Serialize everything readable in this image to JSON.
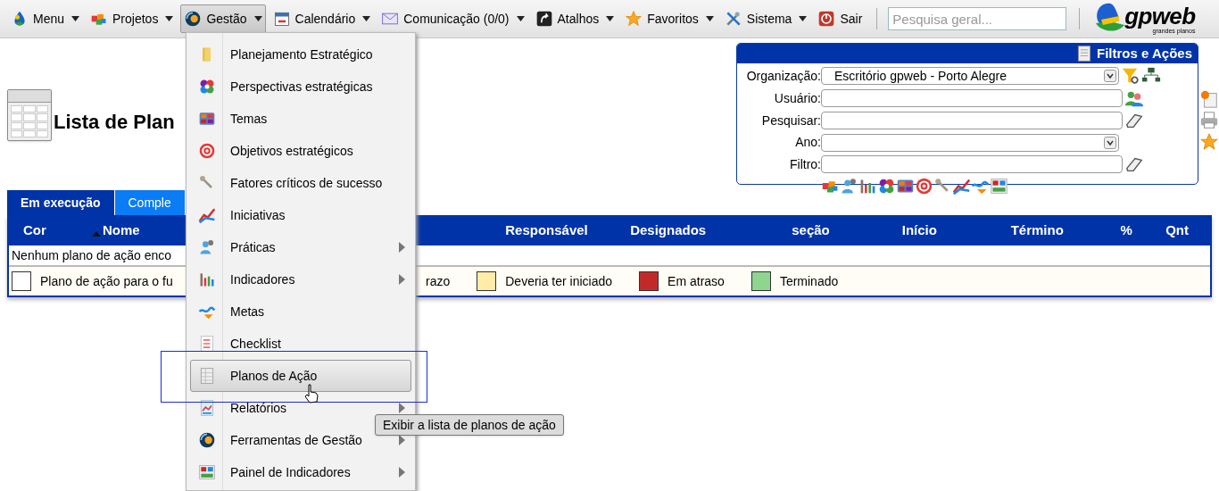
{
  "top_menu": [
    {
      "label": "Menu",
      "has_caret": true,
      "selected": false
    },
    {
      "label": "Projetos",
      "has_caret": true,
      "selected": false
    },
    {
      "label": "Gestão",
      "has_caret": true,
      "selected": true
    },
    {
      "label": "Calendário",
      "has_caret": true,
      "selected": false
    },
    {
      "label": "Comunicação (0/0)",
      "has_caret": true,
      "selected": false
    },
    {
      "label": "Atalhos",
      "has_caret": true,
      "selected": false
    },
    {
      "label": "Favoritos",
      "has_caret": true,
      "selected": false
    },
    {
      "label": "Sistema",
      "has_caret": true,
      "selected": false
    },
    {
      "label": "Sair",
      "has_caret": false,
      "selected": false
    }
  ],
  "search": {
    "placeholder": "Pesquisa geral..."
  },
  "logo": {
    "name": "gpweb",
    "tagline": "grandes planos"
  },
  "page_title": "Lista de Plan",
  "filters": {
    "title": "Filtros e Ações",
    "fields": [
      {
        "label": "Organização:",
        "kind": "select",
        "value": "Escritório gpweb - Porto Alegre"
      },
      {
        "label": "Usuário:",
        "kind": "input"
      },
      {
        "label": "Pesquisar:",
        "kind": "input"
      },
      {
        "label": "Ano:",
        "kind": "select"
      },
      {
        "label": "Filtro:",
        "kind": "input"
      }
    ]
  },
  "tabs": [
    {
      "label": "Em execução",
      "selected": true
    },
    {
      "label": "Comple",
      "selected": false
    }
  ],
  "table": {
    "columns": [
      "Cor",
      "Nome",
      "Responsável",
      "Designados",
      "seção",
      "Início",
      "Término",
      "%",
      "Qnt"
    ],
    "empty_message": "Nenhum plano de ação enco"
  },
  "legend": [
    {
      "label": "Plano de ação para o fu",
      "color": "#ffffff"
    },
    {
      "label": "razo"
    },
    {
      "label": "Deveria ter iniciado",
      "color": "#ffeca8"
    },
    {
      "label": "Em atraso",
      "color": "#c22a2a"
    },
    {
      "label": "Terminado",
      "color": "#8ed68e"
    }
  ],
  "dropdown": [
    {
      "label": "Planejamento Estratégico",
      "has_submenu": false,
      "selected": false
    },
    {
      "label": "Perspectivas estratégicas",
      "has_submenu": false,
      "selected": false
    },
    {
      "label": "Temas",
      "has_submenu": false,
      "selected": false
    },
    {
      "label": "Objetivos estratégicos",
      "has_submenu": false,
      "selected": false
    },
    {
      "label": "Fatores críticos de sucesso",
      "has_submenu": false,
      "selected": false
    },
    {
      "label": "Iniciativas",
      "has_submenu": false,
      "selected": false
    },
    {
      "label": "Práticas",
      "has_submenu": true,
      "selected": false
    },
    {
      "label": "Indicadores",
      "has_submenu": true,
      "selected": false
    },
    {
      "label": "Metas",
      "has_submenu": false,
      "selected": false
    },
    {
      "label": "Checklist",
      "has_submenu": false,
      "selected": false
    },
    {
      "label": "Planos de Ação",
      "has_submenu": false,
      "selected": true
    },
    {
      "label": "Relatórios",
      "has_submenu": true,
      "selected": false
    },
    {
      "label": "Ferramentas de Gestão",
      "has_submenu": true,
      "selected": false
    },
    {
      "label": "Painel de Indicadores",
      "has_submenu": true,
      "selected": false
    }
  ],
  "tooltip": "Exibir a lista de planos de ação"
}
